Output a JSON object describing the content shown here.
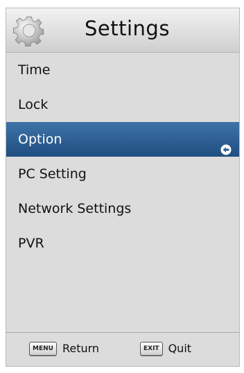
{
  "header": {
    "title": "Settings",
    "icon": "gear-icon"
  },
  "menu": {
    "items": [
      {
        "label": "Time"
      },
      {
        "label": "Lock"
      },
      {
        "label": "Option",
        "selected": true
      },
      {
        "label": "PC Setting"
      },
      {
        "label": "Network Settings"
      },
      {
        "label": "PVR"
      }
    ]
  },
  "footer": {
    "return_key": "MENU",
    "return_label": "Return",
    "quit_key": "EXIT",
    "quit_label": "Quit"
  },
  "colors": {
    "selected_bg": "#2b5d92",
    "panel_bg": "#dcdcdc"
  }
}
